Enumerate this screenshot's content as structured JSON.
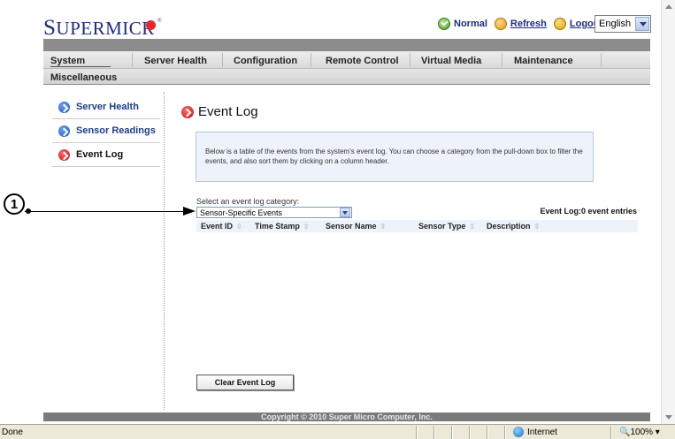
{
  "brand": {
    "logo_first": "S",
    "logo_rest": "UPERMICR"
  },
  "topbar": {
    "status": "Normal",
    "refresh": "Refresh",
    "logout": "Logout",
    "language": "English"
  },
  "nav": {
    "items": [
      "System",
      "Server Health",
      "Configuration",
      "Remote Control",
      "Virtual Media",
      "Maintenance"
    ],
    "second_row": "Miscellaneous"
  },
  "sidebar": {
    "items": [
      {
        "label": "Server Health"
      },
      {
        "label": "Sensor Readings"
      },
      {
        "label": "Event Log"
      }
    ]
  },
  "main": {
    "title": "Event Log",
    "info": "Below is a table of the events from the system's event log. You can choose a category from the pull-down box to filter the events, and also sort them by clicking on a column header.",
    "category_label": "Select an event log category:",
    "category_value": "Sensor-Specific Events",
    "event_count": "Event Log:0 event entries",
    "columns": [
      "Event ID",
      "Time Stamp",
      "Sensor Name",
      "Sensor Type",
      "Description"
    ],
    "clear_button": "Clear Event Log"
  },
  "callout": {
    "number": "1"
  },
  "footer": {
    "copyright": "Copyright © 2010 Super Micro Computer, Inc."
  },
  "statusbar": {
    "left": "Done",
    "zone": "Internet",
    "zoom": "100%"
  }
}
